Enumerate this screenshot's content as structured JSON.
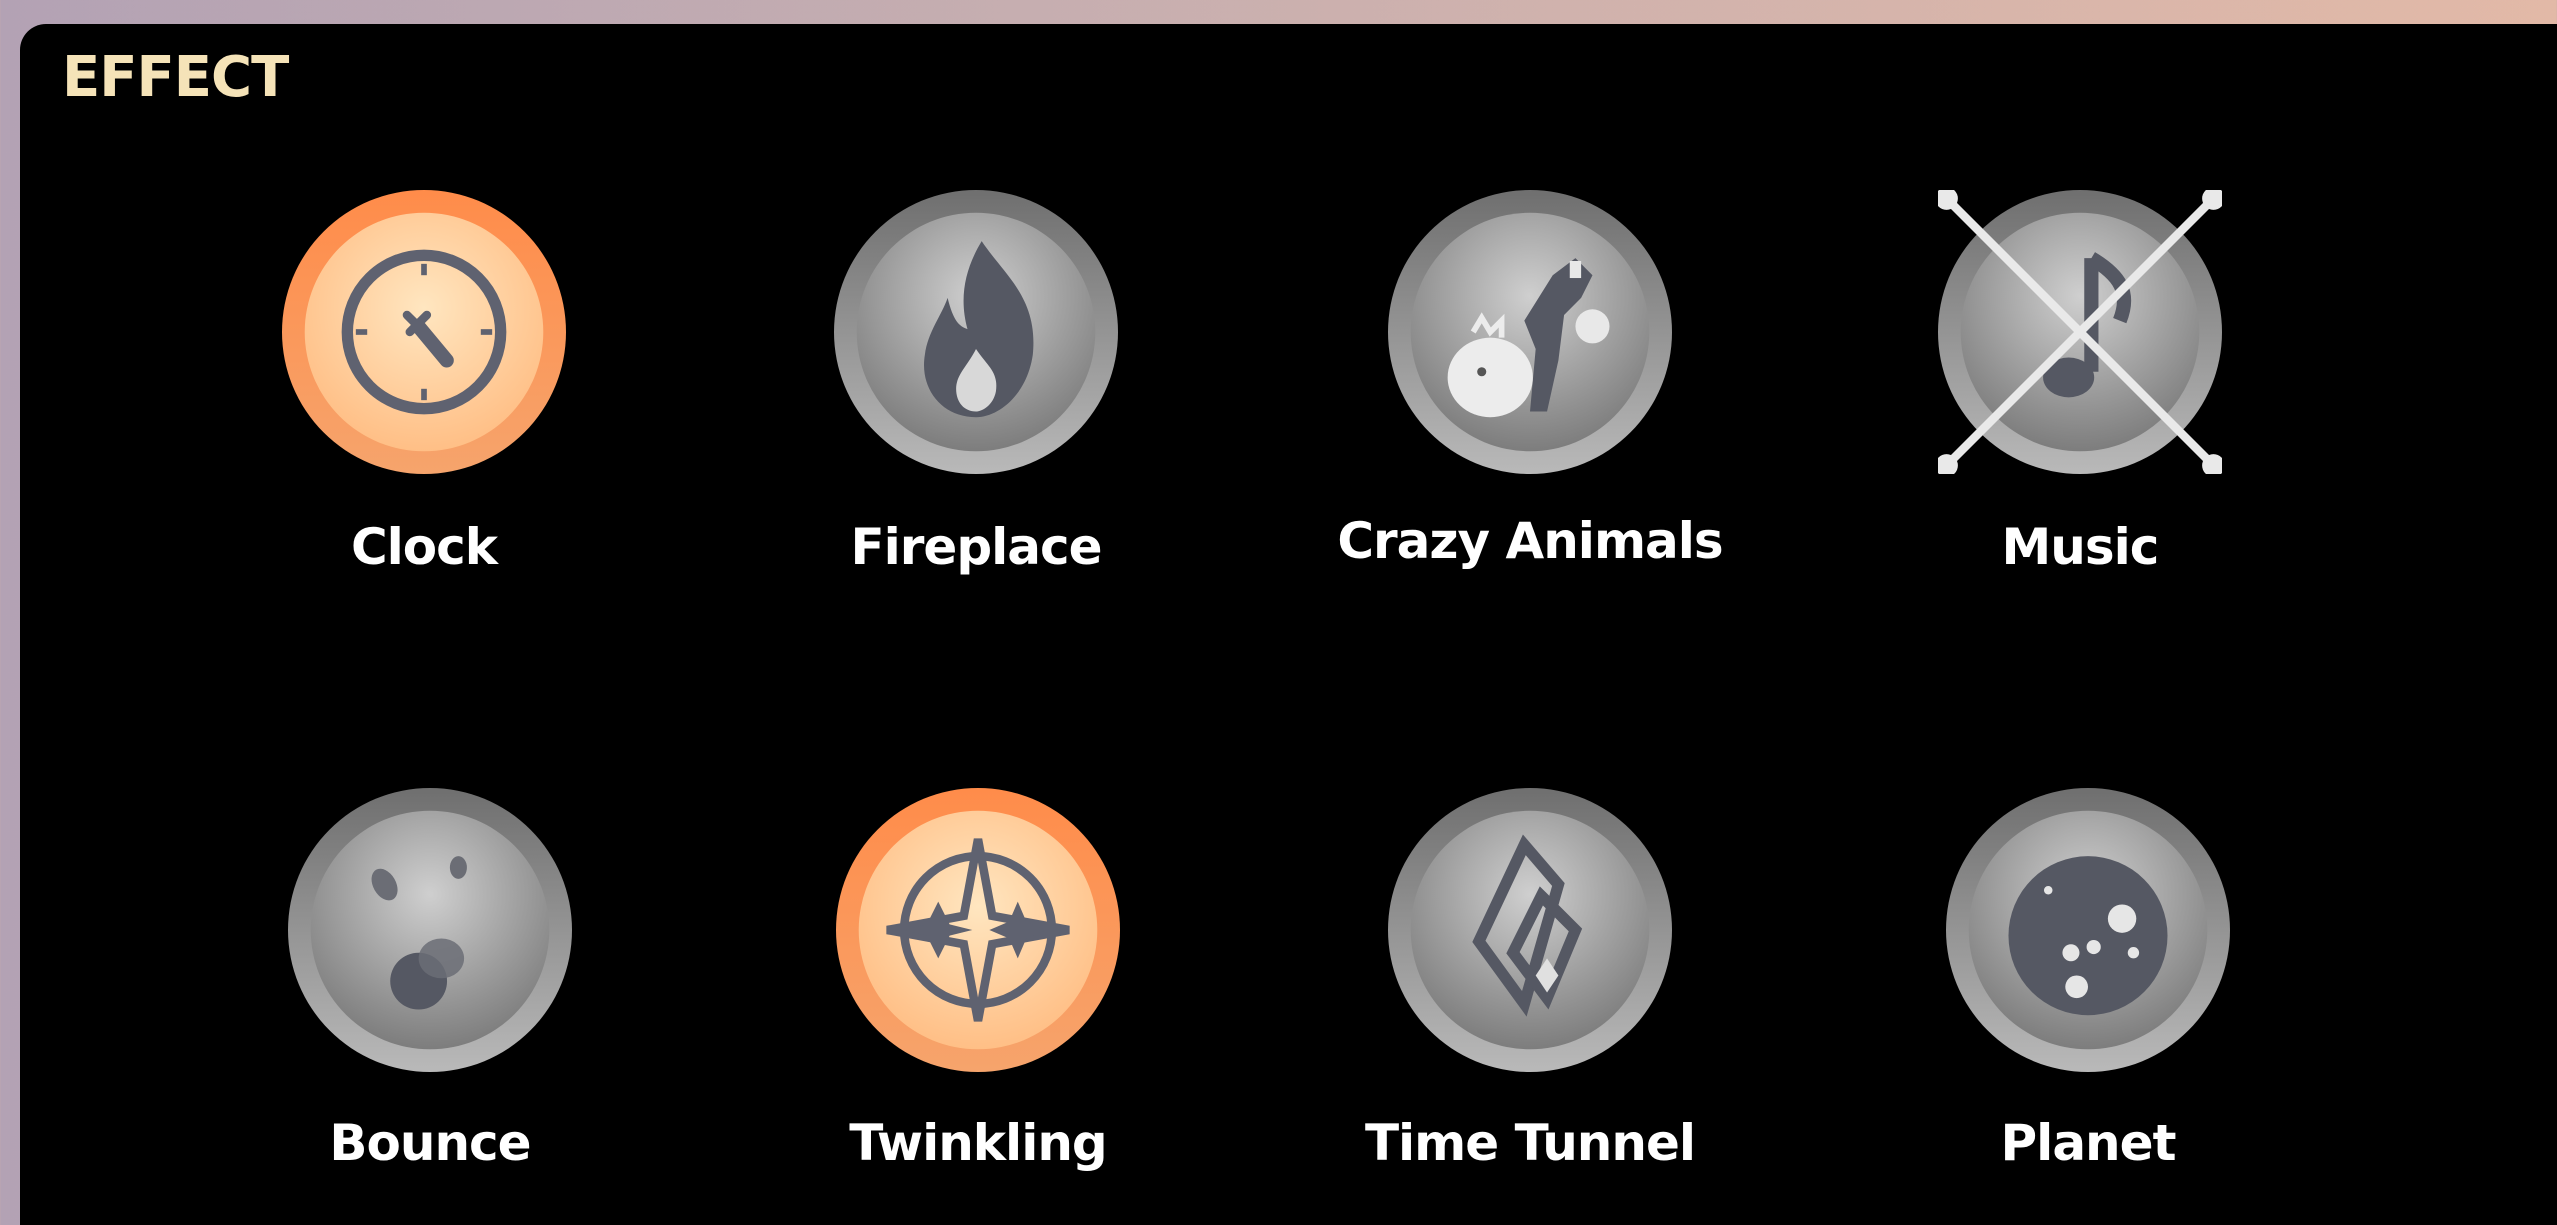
{
  "panel": {
    "title": "EFFECT"
  },
  "colors": {
    "active_ring": "#f59a5b",
    "active_inner": "#ffd9a8",
    "inactive_ring": "#8a8a8a",
    "inactive_inner": "#b8b8b8",
    "glyph": "#5f6270",
    "title": "#f5e3b8"
  },
  "effects": [
    {
      "label": "Clock",
      "icon": "clock-icon",
      "selected": true,
      "disabled": false
    },
    {
      "label": "Fireplace",
      "icon": "flame-icon",
      "selected": false,
      "disabled": false
    },
    {
      "label": "Crazy Animals",
      "icon": "animals-icon",
      "selected": false,
      "disabled": false
    },
    {
      "label": "Music",
      "icon": "music-note-icon",
      "selected": false,
      "disabled": true
    },
    {
      "label": "Bounce",
      "icon": "bouncing-ball-icon",
      "selected": false,
      "disabled": false
    },
    {
      "label": "Twinkling",
      "icon": "sparkle-icon",
      "selected": true,
      "disabled": false
    },
    {
      "label": "Time Tunnel",
      "icon": "tunnel-icon",
      "selected": false,
      "disabled": false
    },
    {
      "label": "Planet",
      "icon": "planet-icon",
      "selected": false,
      "disabled": false
    }
  ]
}
